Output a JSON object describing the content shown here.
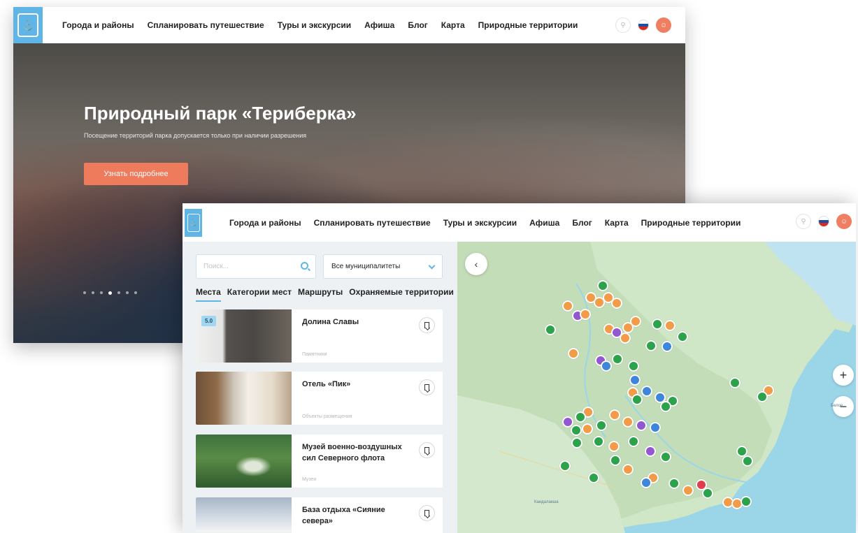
{
  "nav": {
    "items": [
      "Города и районы",
      "Спланировать путешествие",
      "Туры и экскурсии",
      "Афиша",
      "Блог",
      "Карта",
      "Природные территории"
    ]
  },
  "hero": {
    "title": "Природный парк «Териберка»",
    "subtitle": "Посещение территорий парка допускается только при наличии разрешения",
    "button": "Узнать подробнее",
    "active_slide": 4,
    "slide_count": 7
  },
  "filters": {
    "search_placeholder": "Поиск...",
    "municipality": "Все муниципалитеты"
  },
  "tabs": [
    "Места",
    "Категории мест",
    "Маршруты",
    "Охраняемые территории"
  ],
  "cards": [
    {
      "title": "Долина Славы",
      "category": "Памятники",
      "rating": "5.0"
    },
    {
      "title": "Отель «Пик»",
      "category": "Объекты размещения"
    },
    {
      "title": "Музей военно-воздушных сил Северного флота",
      "category": "Музеи"
    },
    {
      "title": "База отдыха «Сияние севера»",
      "category": ""
    }
  ],
  "map": {
    "zoom_in": "+",
    "zoom_out": "−",
    "back": "‹",
    "labels": [
      "Белое",
      "Кандалакша"
    ]
  },
  "colors": {
    "accent": "#5fb6e6",
    "cta": "#ee7b5c",
    "marker_orange": "#f29b48",
    "marker_green": "#2ca24a",
    "marker_purple": "#9158d1",
    "marker_blue": "#3d86da",
    "user_avatar": "#f07e61"
  }
}
